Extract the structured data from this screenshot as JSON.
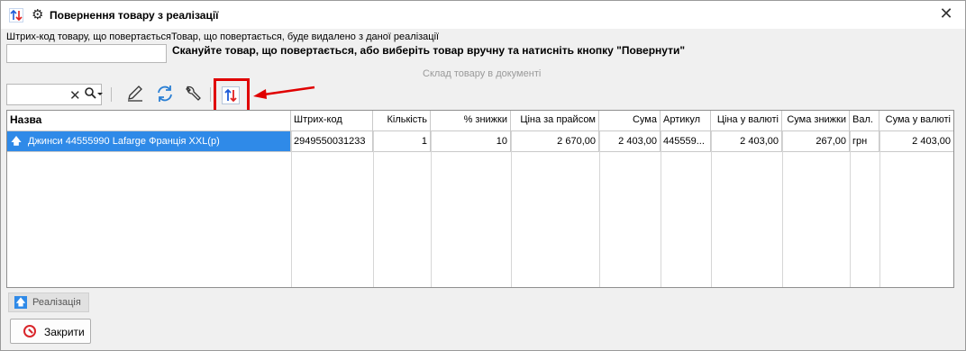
{
  "window": {
    "title": "Повернення товару з реалізації",
    "close": "✕"
  },
  "barcode": {
    "label": "Штрих-код товару, що повертаєтьсяТовар, що повертається, буде видалено з даної реалізації",
    "value": "",
    "hint": "Скануйте товар, що повертається, або виберіть товар вручну та натисніть кнопку \"Повернути\""
  },
  "warehouse_label": "Склад товару в документі",
  "toolbar": {
    "search_value": "",
    "clear_icon": "close-icon",
    "search_icon": "search-icon",
    "edit_icon": "pencil-icon",
    "refresh_icon": "refresh-icon",
    "settings_icon": "wrench-icon",
    "return_icon": "swap-arrows-icon"
  },
  "grid": {
    "columns": [
      "Назва",
      "Штрих-код",
      "Кількість",
      "% знижки",
      "Ціна за прайсом",
      "Сума",
      "Артикул",
      "Ціна у валюті",
      "Сума знижки",
      "Вал.",
      "Сума у валюті"
    ],
    "rows": [
      {
        "name": "Джинси 44555990 Lafarge Франція XXL(р)",
        "barcode": "2949550031233",
        "qty": "1",
        "discount_pct": "10",
        "price_list": "2 670,00",
        "sum": "2 403,00",
        "article": "445559...",
        "price_currency": "2 403,00",
        "discount_sum": "267,00",
        "currency": "грн",
        "sum_currency": "2 403,00"
      }
    ]
  },
  "footer": {
    "sale_tab": "Реалізація",
    "close_button": "Закрити"
  },
  "colors": {
    "selection": "#2f8ae8",
    "highlight": "#e00000"
  }
}
